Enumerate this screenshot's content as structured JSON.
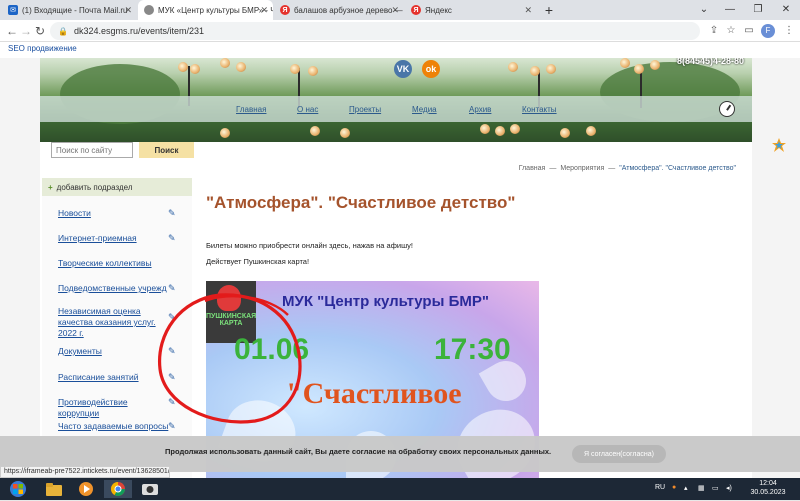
{
  "browser": {
    "tabs": [
      {
        "label": "(1) Входящие - Почта Mail.ru",
        "favicon": "mail-icon",
        "color": "#1c64c6"
      },
      {
        "label": "МУК «Центр культуры БМР» - Ч...",
        "favicon": "globe-icon",
        "color": "#555555"
      },
      {
        "label": "балашов арбузное дерево — Я...",
        "favicon": "yandex-icon",
        "color": "#e5322d"
      },
      {
        "label": "Яндекс",
        "favicon": "yandex-icon",
        "color": "#e5322d"
      }
    ],
    "url": "dk324.esgms.ru/events/item/231",
    "bookmark": "SEO продвижение",
    "profile_initial": "F"
  },
  "site": {
    "phone": "8(84545)4-28-80",
    "social": {
      "vk": "VK",
      "ok": "ok"
    },
    "nav": [
      "Главная",
      "О нас",
      "Проекты",
      "Медиа",
      "Архив",
      "Контакты"
    ],
    "search": {
      "placeholder": "Поиск по сайту",
      "button": "Поиск"
    },
    "sidebar": {
      "add": "добавить подраздел",
      "items": [
        "Новости",
        "Интернет-приемная",
        "Творческие коллективы",
        "Подведомственные учрежд",
        "Независимая оценка качества оказания услуг. 2022 г.",
        "Документы",
        "Расписание занятий",
        "Противодействие коррупции",
        "Часто задаваемые вопросы"
      ]
    },
    "breadcrumb": [
      "Главная",
      "Мероприятия",
      "\"Атмосфера\". \"Счастливое детство\""
    ],
    "title": "\"Атмосфера\". \"Счастливое детство\"",
    "paragraphs": [
      "Билеты можно приобрести онлайн здесь, нажав на афишу!",
      "Действует Пушкинская карта!"
    ],
    "poster": {
      "brand": "ПУШКИНСКАЯ КАРТА",
      "org": "МУК \"Центр культуры БМР\"",
      "date": "01.06",
      "time": "17:30",
      "show": "\"Счастливое"
    }
  },
  "cookie": {
    "text": "Продолжая использовать данный сайт, Вы даете согласие на обработку своих персональных данных.",
    "button": "Я согласен(согласна)"
  },
  "status_url": "https://iframeab-pre7522.intickets.ru/event/13628501/",
  "taskbar": {
    "lang": "RU",
    "time": "12:04",
    "date": "30.05.2023"
  },
  "colors": {
    "accent_title": "#a5532c",
    "link": "#1a4f9a",
    "vk": "#4a76a8",
    "ok": "#ee8208"
  }
}
